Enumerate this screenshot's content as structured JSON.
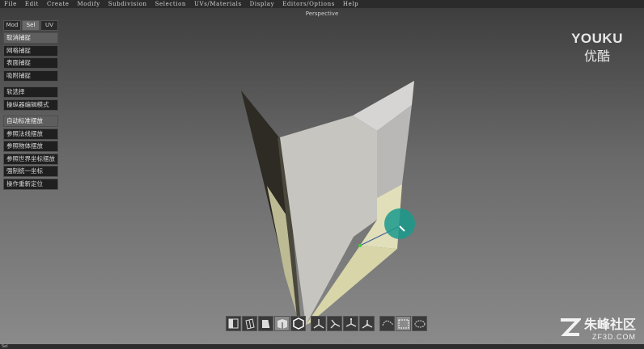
{
  "menu": [
    "File",
    "Edit",
    "Create",
    "Modify",
    "Subdivision",
    "Selection",
    "UVs/Materials",
    "Display",
    "Editors/Options",
    "Help"
  ],
  "viewport": {
    "label": "Perspective"
  },
  "panel": {
    "modes": [
      "Mod",
      "Sel",
      "UV"
    ],
    "active_mode": "Sel",
    "group1": [
      "取消捕捉",
      "网格捕捉",
      "表面捕捉",
      "吸附捕捉"
    ],
    "group2": [
      "软选择",
      "操纵器编辑模式"
    ],
    "group3": [
      "自动标准摆放",
      "参照法线摆放",
      "参照物体摆放",
      "参照世界坐标摆放",
      "强制统一坐标",
      "操作重新定位"
    ]
  },
  "watermarks": {
    "youku_en": "YOUKU",
    "youku_cn": "优酷",
    "zf_cn": "朱峰社区",
    "zf_en": "ZF3D.COM"
  },
  "toolbar": {
    "icons": [
      "cube-face-icon",
      "cube-edge-icon",
      "cube-side-icon",
      "cube-front-icon",
      "hexagon-icon",
      "move-axis-icon",
      "rotate-axis-icon",
      "scale-axis-icon",
      "universal-axis-icon",
      "lasso-icon",
      "marquee-select-icon",
      "paint-select-icon"
    ]
  },
  "status": {
    "text": "Sel"
  },
  "colors": {
    "accent": "#1a9a8c",
    "highlight": "#dcdab0"
  }
}
